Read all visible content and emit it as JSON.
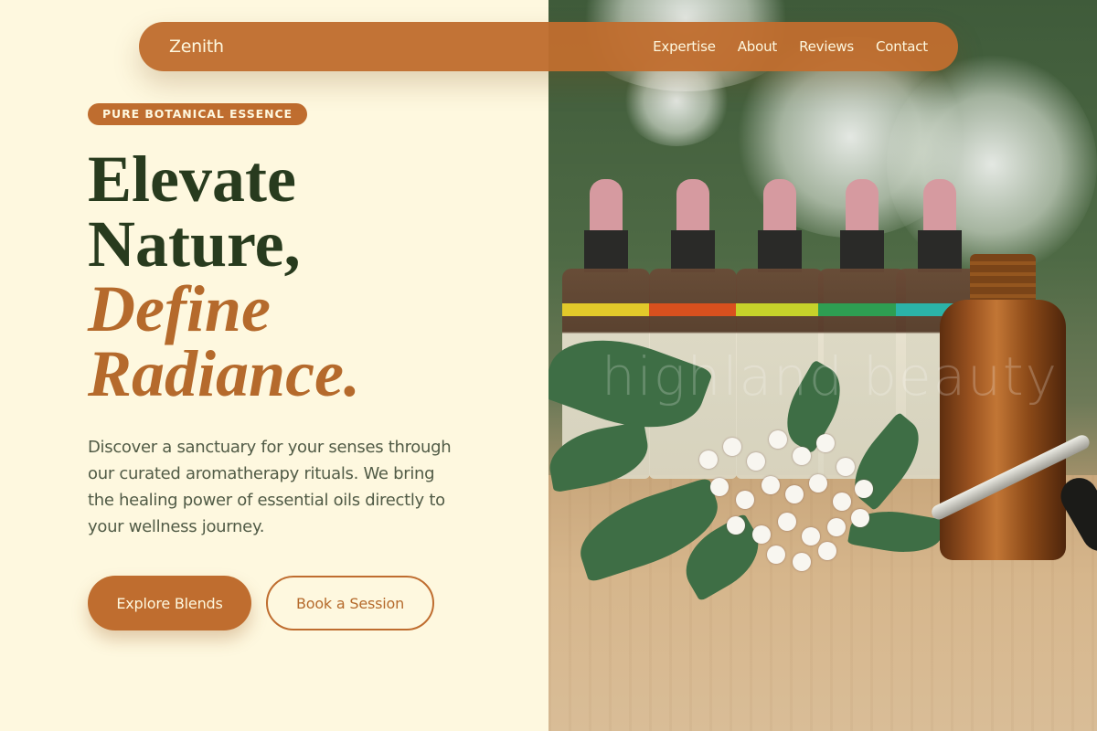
{
  "nav": {
    "brand": "Zenith",
    "links": [
      "Expertise",
      "About",
      "Reviews",
      "Contact"
    ]
  },
  "hero": {
    "badge": "PURE BOTANICAL ESSENCE",
    "headline_line1": "Elevate",
    "headline_line2": "Nature,",
    "headline_accent1": "Define",
    "headline_accent2": "Radiance.",
    "description": "Discover a sanctuary for your senses through our curated aromatherapy rituals. We bring the healing power of essential oils directly to your wellness journey.",
    "primary_button": "Explore Blends",
    "secondary_button": "Book a Session"
  },
  "image": {
    "watermark": "highland beauty"
  },
  "colors": {
    "background": "#FEF8DF",
    "accent": "#BF6D2F",
    "heading_dark": "#283B1E",
    "body_text": "#515B46"
  }
}
